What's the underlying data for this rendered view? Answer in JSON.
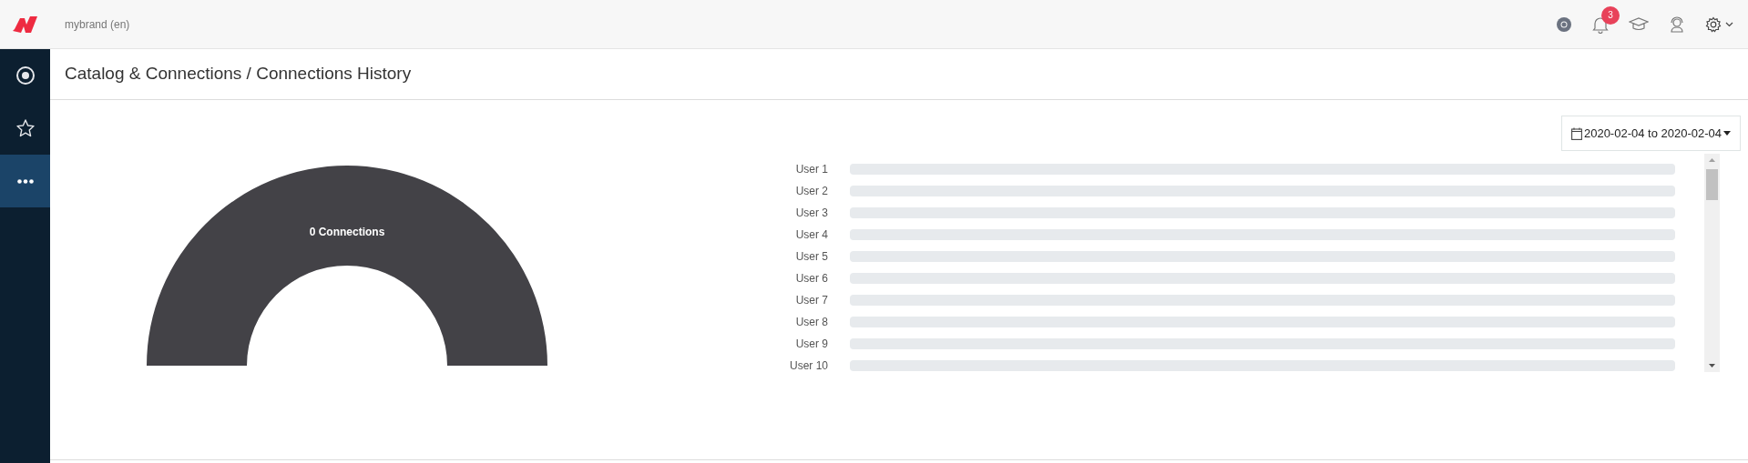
{
  "header": {
    "brand": "mybrand (en)",
    "notifications_badge": "3"
  },
  "sidebar": {
    "items": [
      {
        "kind": "target",
        "selected": false
      },
      {
        "kind": "star",
        "selected": false
      },
      {
        "kind": "more",
        "selected": true
      }
    ]
  },
  "page_title": "Catalog & Connections / Connections History",
  "date_range": "2020-02-04 to 2020-02-04",
  "gauge": {
    "label": "0 Connections"
  },
  "users": [
    {
      "label": "User 1"
    },
    {
      "label": "User 2"
    },
    {
      "label": "User 3"
    },
    {
      "label": "User 4"
    },
    {
      "label": "User 5"
    },
    {
      "label": "User 6"
    },
    {
      "label": "User 7"
    },
    {
      "label": "User 8"
    },
    {
      "label": "User 9"
    },
    {
      "label": "User 10"
    }
  ]
}
